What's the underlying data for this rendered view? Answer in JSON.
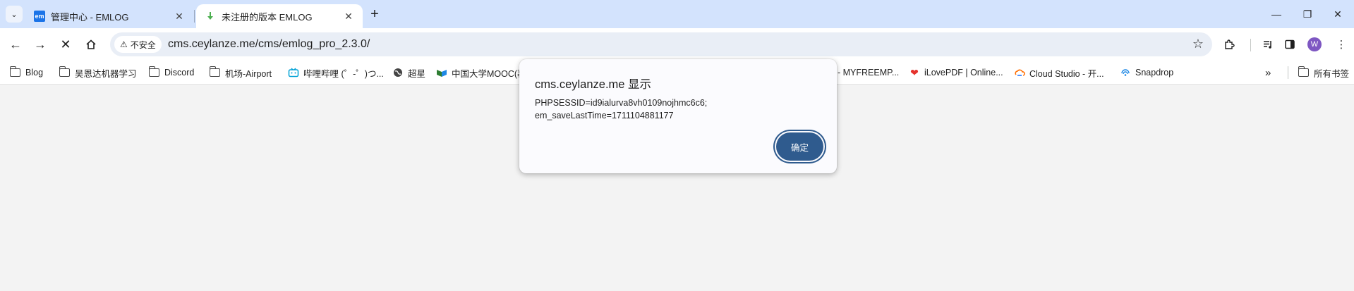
{
  "tabs": [
    {
      "label": "管理中心 - EMLOG",
      "favicon_text": "em"
    },
    {
      "label": "未注册的版本 EMLOG"
    }
  ],
  "toolbar": {
    "security_label": "不安全",
    "url": "cms.ceylanze.me/cms/emlog_pro_2.3.0/",
    "avatar_letter": "W"
  },
  "bookmarks": {
    "items": [
      {
        "label": "Blog",
        "icon": "folder-icon"
      },
      {
        "label": "吴恩达机器学习",
        "icon": "folder-icon"
      },
      {
        "label": "Discord",
        "icon": "folder-icon"
      },
      {
        "label": "机场-Airport",
        "icon": "folder-icon"
      },
      {
        "label": "哔哩哔哩 (゜-゜)つ...",
        "icon": "bilibili-icon"
      },
      {
        "label": "超星",
        "icon": "globe-icon"
      },
      {
        "label": "中国大学MOOC(慕",
        "icon": "mooc-icon"
      },
      {
        "label": "- MYFREEMP...",
        "icon": "none"
      },
      {
        "label": "iLovePDF | Online...",
        "icon": "heart-icon"
      },
      {
        "label": "Cloud Studio - 开...",
        "icon": "cloud-studio-icon"
      },
      {
        "label": "Snapdrop",
        "icon": "snapdrop-icon"
      }
    ],
    "all_bookmarks_label": "所有书签"
  },
  "dialog": {
    "title": "cms.ceylanze.me 显示",
    "message_line1": "PHPSESSID=id9ialurva8vh0109nojhmc6c6;",
    "message_line2": "em_saveLastTime=1711104881177",
    "ok_label": "确定"
  }
}
